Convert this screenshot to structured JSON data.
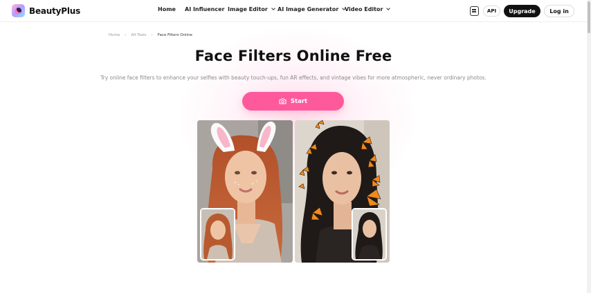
{
  "brand": {
    "name": "BeautyPlus"
  },
  "nav": {
    "items": [
      {
        "label": "Home",
        "dropdown": false
      },
      {
        "label": "AI Influencer",
        "dropdown": false
      },
      {
        "label": "Image Editor",
        "dropdown": true
      },
      {
        "label": "AI Image Generator",
        "dropdown": true
      },
      {
        "label": "Video Editor",
        "dropdown": true
      }
    ],
    "api_label": "API",
    "upgrade_label": "Upgrade",
    "login_label": "Log in"
  },
  "breadcrumb": [
    "Home",
    "All Tools",
    "Face Filters Online"
  ],
  "hero": {
    "title": "Face Filters Online Free",
    "subtitle": "Try online face filters to enhance your selfies with beauty touch-ups, fun AR effects, and vintage vibes for more atmospheric, never ordinary photos.",
    "start_label": "Start"
  },
  "colors": {
    "accent": "#fe5a9b",
    "upgrade_bg": "#111111"
  },
  "icons": [
    "app-download-icon",
    "camera-icon",
    "chevron-down-icon"
  ]
}
